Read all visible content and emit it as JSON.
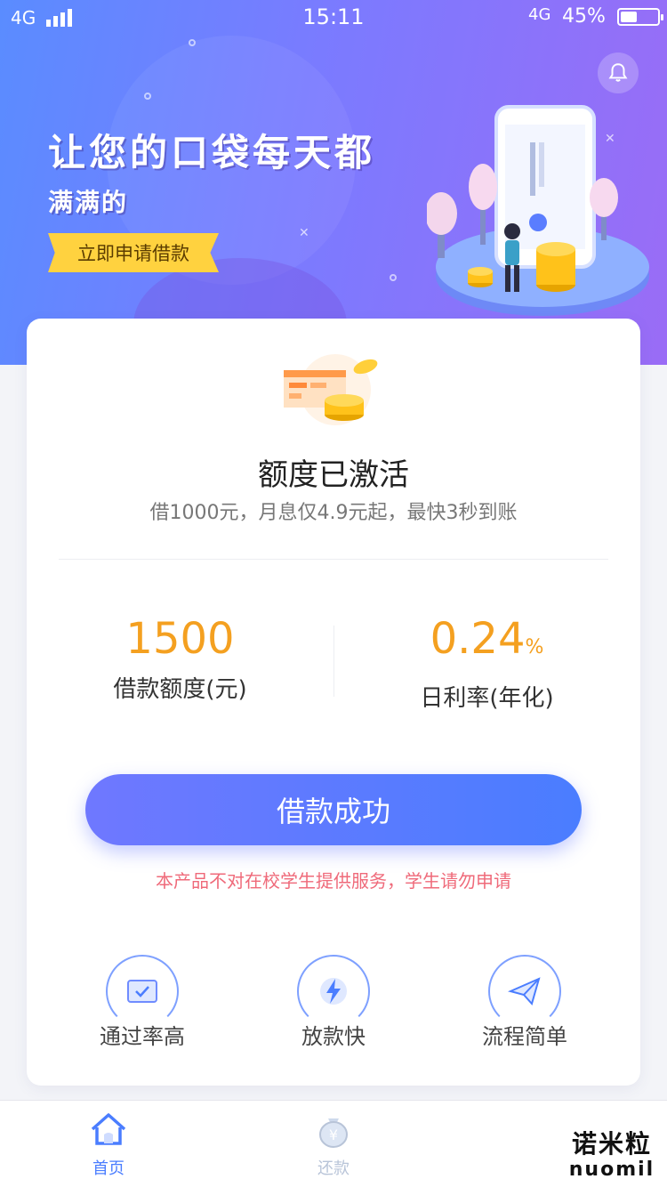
{
  "status_bar": {
    "network_left": "4G",
    "time": "15:11",
    "network_right": "4G",
    "battery": "45%",
    "battery_level": 0.45
  },
  "banner": {
    "slogan_line1": "让您的口袋每天都",
    "slogan_line2": "满满的",
    "apply_button": "立即申请借款"
  },
  "quota": {
    "headline": "额度已激活",
    "subline": "借1000元，月息仅4.9元起，最快3秒到账"
  },
  "stats": {
    "amount": {
      "value": "1500",
      "label": "借款额度(元)"
    },
    "rate": {
      "value": "0.24",
      "unit": "%",
      "label": "日利率(年化)"
    }
  },
  "loan_button": "借款成功",
  "notice": "本产品不对在校学生提供服务，学生请勿申请",
  "features": [
    {
      "label": "通过率高",
      "icon": "ticket-check-icon"
    },
    {
      "label": "放款快",
      "icon": "lightning-icon"
    },
    {
      "label": "流程简单",
      "icon": "paper-plane-icon"
    }
  ],
  "tabbar": {
    "tabs": [
      {
        "label": "首页",
        "icon": "home-icon",
        "active": true
      },
      {
        "label": "还款",
        "icon": "money-bag-icon",
        "active": false
      }
    ]
  },
  "watermark": {
    "line1": "诺米粒",
    "line2": "nuomil"
  },
  "colors": {
    "accent": "#4a7dff",
    "amount": "#f4a020",
    "notice": "#ef6a7a",
    "tag": "#ffd23f"
  }
}
